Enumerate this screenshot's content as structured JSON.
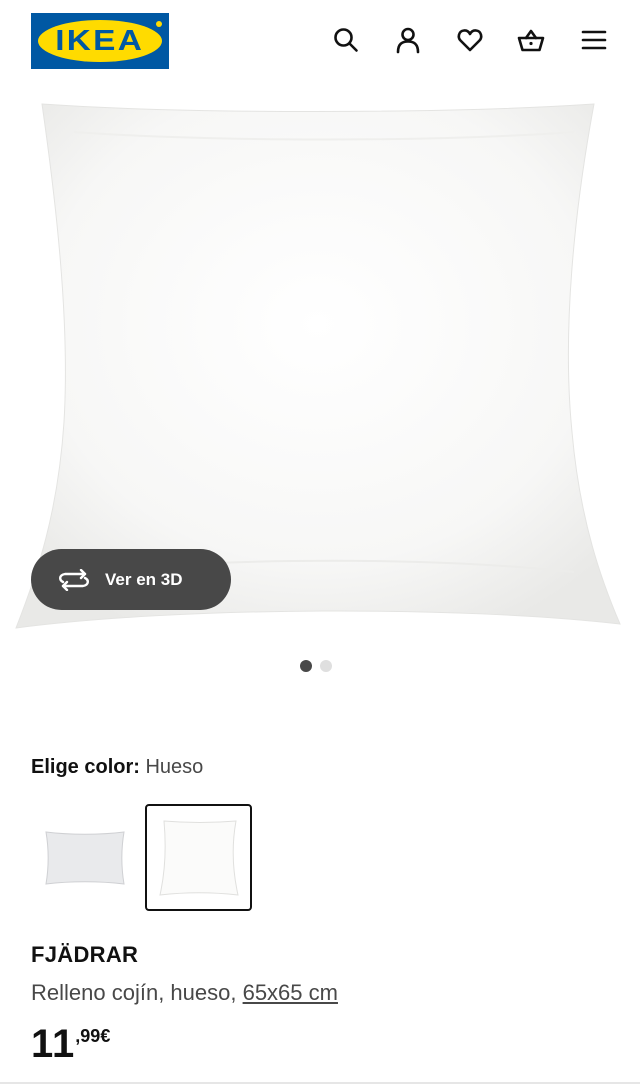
{
  "header": {
    "logo_text": "IKEA",
    "icons": [
      "search-icon",
      "user-icon",
      "heart-icon",
      "basket-icon",
      "menu-icon"
    ]
  },
  "gallery": {
    "view_3d_label": "Ver en 3D",
    "slide_count": 2,
    "active_slide": 1
  },
  "color": {
    "label": "Elige color:",
    "value": "Hueso",
    "swatches": [
      {
        "name": "rectangular-pillow",
        "selected": false
      },
      {
        "name": "square-pillow",
        "selected": true
      }
    ]
  },
  "product": {
    "name": "FJÄDRAR",
    "description": "Relleno cojín, hueso, ",
    "size": "65x65 cm",
    "price_integer": "11",
    "price_decimal": ",99€"
  },
  "colors": {
    "brand_blue": "#0058a3",
    "brand_yellow": "#ffdb00",
    "button_dark": "#484848",
    "text": "#111111",
    "secondary_text": "#484848"
  }
}
